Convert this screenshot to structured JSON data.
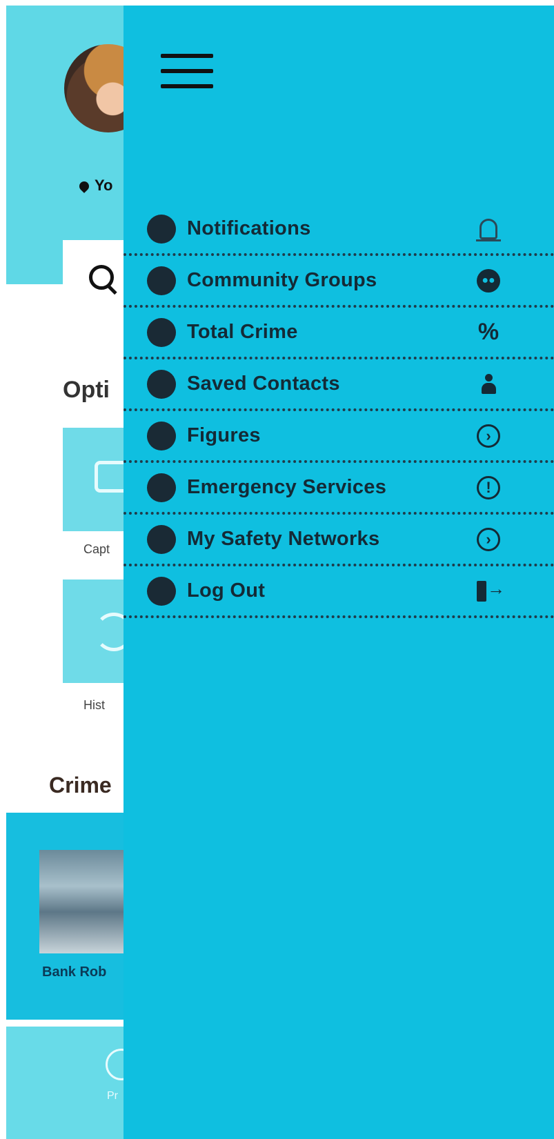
{
  "background": {
    "location_text": "Yo",
    "options_heading": "Opti",
    "tile_capture_label": "Capt",
    "tile_history_label": "Hist",
    "crime_heading": "Crime",
    "crime_card_caption": "Bank Rob",
    "nav_profile_label": "Pr"
  },
  "drawer": {
    "menu_icon": "hamburger-icon",
    "items": [
      {
        "label": "Notifications",
        "icon": "bell-icon"
      },
      {
        "label": "Community Groups",
        "icon": "group-icon"
      },
      {
        "label": "Total Crime",
        "icon": "percent-icon",
        "glyph": "%"
      },
      {
        "label": "Saved Contacts",
        "icon": "person-icon"
      },
      {
        "label": "Figures",
        "icon": "chevron-right-circle-icon",
        "glyph": "›"
      },
      {
        "label": "Emergency Services",
        "icon": "exclamation-circle-icon",
        "glyph": "!"
      },
      {
        "label": "My Safety Networks",
        "icon": "chevron-right-circle-icon",
        "glyph": "›"
      },
      {
        "label": "Log Out",
        "icon": "logout-door-icon"
      }
    ]
  },
  "colors": {
    "drawer_bg": "#0fbfe0",
    "header_bg": "#5fd8e6",
    "text_dark": "#142a36"
  }
}
